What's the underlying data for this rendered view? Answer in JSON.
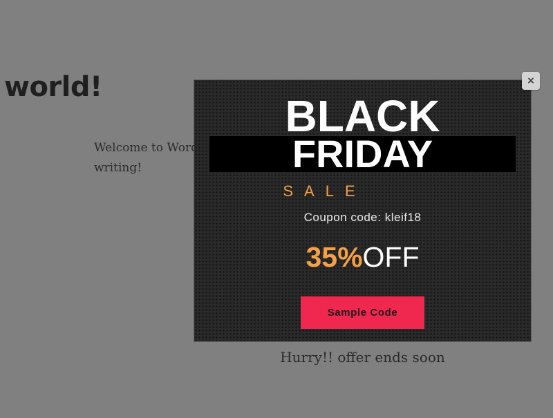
{
  "background": {
    "title": "world!",
    "body_line_1": "Welcome to Word",
    "body_line_2": "writing!"
  },
  "popup": {
    "close_icon": "×",
    "headline_line_1": "BLACK",
    "headline_line_2": "FRIDAY",
    "sale_label": "SALE",
    "coupon_text": "Coupon code: kleif18",
    "discount_percent": "35%",
    "discount_suffix": "OFF",
    "cta_label": "Sample Code",
    "footer_note": "Hurry!! offer ends soon"
  },
  "colors": {
    "overlay": "#808080",
    "popup_bg": "#2a2a2a",
    "accent_orange": "#f4a046",
    "cta_red": "#f0284f"
  }
}
